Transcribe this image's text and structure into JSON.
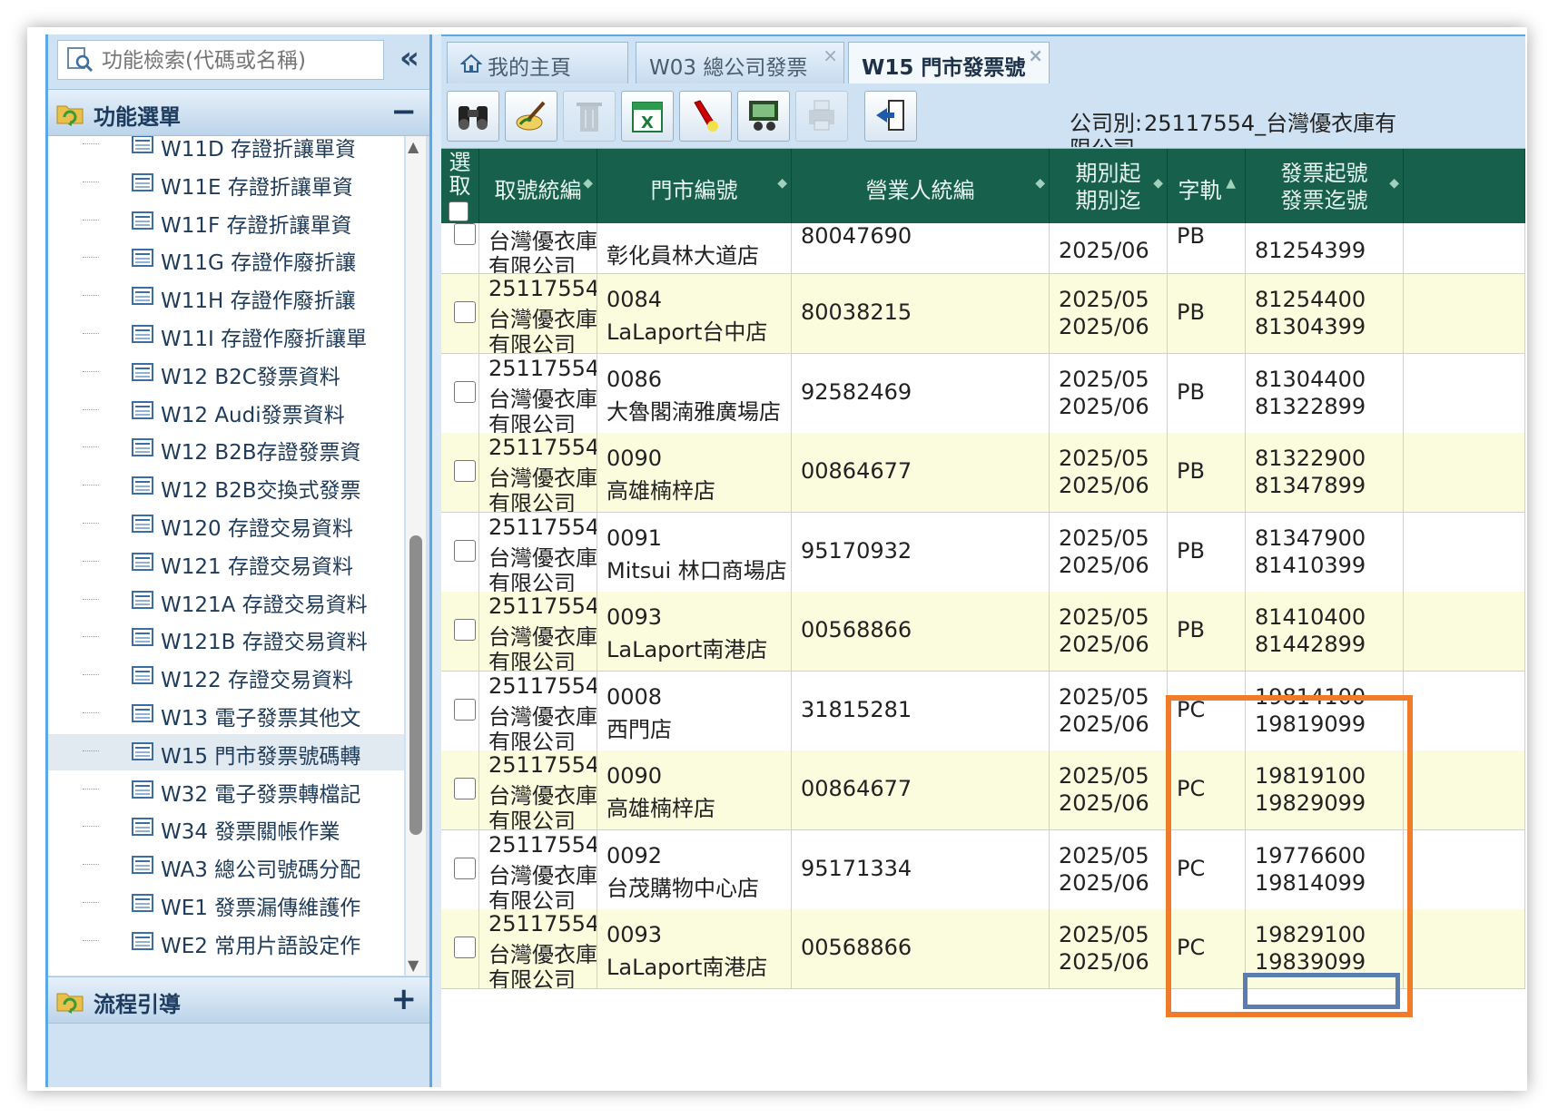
{
  "sidebar": {
    "search_placeholder": "功能檢索(代碼或名稱)",
    "collapse_glyph": "«",
    "menu_section_label": "功能選單",
    "menu_section_toggle": "−",
    "flow_section_label": "流程引導",
    "flow_section_toggle": "+",
    "items": [
      {
        "label": "W11D 存證折讓單資"
      },
      {
        "label": "W11E 存證折讓單資"
      },
      {
        "label": "W11F 存證折讓單資"
      },
      {
        "label": "W11G 存證作廢折讓"
      },
      {
        "label": "W11H 存證作廢折讓"
      },
      {
        "label": "W11I 存證作廢折讓單"
      },
      {
        "label": "W12 B2C發票資料"
      },
      {
        "label": "W12 Audi發票資料"
      },
      {
        "label": "W12 B2B存證發票資"
      },
      {
        "label": "W12 B2B交換式發票"
      },
      {
        "label": "W120 存證交易資料"
      },
      {
        "label": "W121 存證交易資料"
      },
      {
        "label": "W121A 存證交易資料"
      },
      {
        "label": "W121B 存證交易資料"
      },
      {
        "label": "W122 存證交易資料"
      },
      {
        "label": "W13 電子發票其他文"
      },
      {
        "label": "W15 門市發票號碼轉",
        "selected": true
      },
      {
        "label": "W32 電子發票轉檔記"
      },
      {
        "label": "W34 發票關帳作業"
      },
      {
        "label": "WA3 總公司號碼分配"
      },
      {
        "label": "WE1 發票漏傳維護作"
      },
      {
        "label": "WE2 常用片語設定作"
      }
    ]
  },
  "tabs": [
    {
      "label": "我的主頁",
      "icon": "home-icon"
    },
    {
      "label": "W03 總公司發票",
      "close": "×"
    },
    {
      "label": "W15 門市發票號",
      "close": "×",
      "active": true
    }
  ],
  "toolbar": {
    "buttons": [
      {
        "icon": "binoculars-icon"
      },
      {
        "icon": "edit-brush-icon"
      },
      {
        "icon": "trash-icon",
        "disabled": true
      },
      {
        "icon": "excel-icon"
      },
      {
        "icon": "highlight-icon"
      },
      {
        "icon": "search-people-icon"
      },
      {
        "icon": "print-icon",
        "disabled": true
      },
      {
        "icon": "exit-icon"
      }
    ],
    "company_label": "公司別:",
    "company_value": "25117554_台灣優衣庫有",
    "company_value_cont": "限公司"
  },
  "grid": {
    "headers": {
      "select": [
        "選",
        "取"
      ],
      "company": "取號統編",
      "store": "門市編號",
      "taxid": "營業人統編",
      "period": [
        "期別起",
        "期別迄"
      ],
      "track": "字軌",
      "invoice": [
        "發票起號",
        "發票迄號"
      ]
    },
    "partial_row": {
      "company": [
        "台灣優衣庫",
        "有限公司"
      ],
      "store_name": "彰化員林大道店",
      "taxid": "80047690",
      "period_end": "2025/06",
      "track": "PB",
      "invoice_end": "81254399"
    },
    "rows": [
      {
        "company": [
          "25117554",
          "台灣優衣庫",
          "有限公司"
        ],
        "store_no": "0084",
        "store_name": "LaLaport台中店",
        "taxid": "80038215",
        "period_start": "2025/05",
        "period_end": "2025/06",
        "track": "PB",
        "invoice_start": "81254400",
        "invoice_end": "81304399"
      },
      {
        "company": [
          "25117554",
          "台灣優衣庫",
          "有限公司"
        ],
        "store_no": "0086",
        "store_name": "大魯閣湳雅廣場店",
        "taxid": "92582469",
        "period_start": "2025/05",
        "period_end": "2025/06",
        "track": "PB",
        "invoice_start": "81304400",
        "invoice_end": "81322899"
      },
      {
        "company": [
          "25117554",
          "台灣優衣庫",
          "有限公司"
        ],
        "store_no": "0090",
        "store_name": "高雄楠梓店",
        "taxid": "00864677",
        "period_start": "2025/05",
        "period_end": "2025/06",
        "track": "PB",
        "invoice_start": "81322900",
        "invoice_end": "81347899"
      },
      {
        "company": [
          "25117554",
          "台灣優衣庫",
          "有限公司"
        ],
        "store_no": "0091",
        "store_name": "Mitsui 林口商場店",
        "taxid": "95170932",
        "period_start": "2025/05",
        "period_end": "2025/06",
        "track": "PB",
        "invoice_start": "81347900",
        "invoice_end": "81410399"
      },
      {
        "company": [
          "25117554",
          "台灣優衣庫",
          "有限公司"
        ],
        "store_no": "0093",
        "store_name": "LaLaport南港店",
        "taxid": "00568866",
        "period_start": "2025/05",
        "period_end": "2025/06",
        "track": "PB",
        "invoice_start": "81410400",
        "invoice_end": "81442899"
      },
      {
        "company": [
          "25117554",
          "台灣優衣庫",
          "有限公司"
        ],
        "store_no": "0008",
        "store_name": "西門店",
        "taxid": "31815281",
        "period_start": "2025/05",
        "period_end": "2025/06",
        "track": "PC",
        "invoice_start": "19814100",
        "invoice_end": "19819099"
      },
      {
        "company": [
          "25117554",
          "台灣優衣庫",
          "有限公司"
        ],
        "store_no": "0090",
        "store_name": "高雄楠梓店",
        "taxid": "00864677",
        "period_start": "2025/05",
        "period_end": "2025/06",
        "track": "PC",
        "invoice_start": "19819100",
        "invoice_end": "19829099"
      },
      {
        "company": [
          "25117554",
          "台灣優衣庫",
          "有限公司"
        ],
        "store_no": "0092",
        "store_name": "台茂購物中心店",
        "taxid": "95171334",
        "period_start": "2025/05",
        "period_end": "2025/06",
        "track": "PC",
        "invoice_start": "19776600",
        "invoice_end": "19814099"
      },
      {
        "company": [
          "25117554",
          "台灣優衣庫",
          "有限公司"
        ],
        "store_no": "0093",
        "store_name": "LaLaport南港店",
        "taxid": "00568866",
        "period_start": "2025/05",
        "period_end": "2025/06",
        "track": "PC",
        "invoice_start": "19829100",
        "invoice_end": "19839099"
      }
    ]
  },
  "colors": {
    "header_green": "#16604c",
    "alt_row": "#fbfbde",
    "highlight_orange": "#f07b28",
    "highlight_blue": "#5b7cae"
  }
}
